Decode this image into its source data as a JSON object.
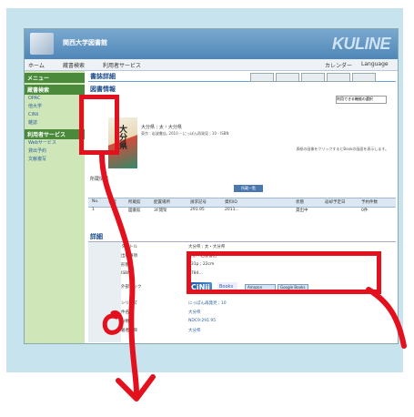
{
  "window": {
    "university_name": "関西大学図書館",
    "brand": "KULINE"
  },
  "nav": {
    "home": "ホーム",
    "catalog": "蔵書検索",
    "service": "利用者サービス",
    "calendar": "カレンダー",
    "language": "Language"
  },
  "sidebar": {
    "menu_head": "メニュー",
    "section1": "蔵書検索",
    "items1": [
      "OPAC",
      "他大学",
      "CiNii",
      "雑誌"
    ],
    "section2": "利用者サービス",
    "items2": [
      "Webサービス",
      "貸出予約",
      "文献複写"
    ]
  },
  "main": {
    "title": "書誌詳細",
    "subtitle": "図書情報",
    "select_label": "利用できる機能の選択"
  },
  "book": {
    "title_vertical": "大分県",
    "bib_line": "大分県 ; 太・大分県",
    "bib_line2": "東京 : 岩波書店, 2010 -- にっぽん再発見 ; 10 - ISBN",
    "note": "表紙の画像をクリックするとBookの画面を表示します。"
  },
  "holdings": {
    "heading": "所蔵情報",
    "button": "所蔵一覧",
    "columns": [
      "No.",
      "巻次",
      "所蔵館",
      "配置場所",
      "請求記号",
      "資料ID",
      "状態",
      "返却予定日",
      "予約件数"
    ],
    "row": [
      "1",
      "",
      "図書館",
      "3F開架",
      "291.95",
      "2011...",
      "貸出中",
      "",
      "0件"
    ]
  },
  "detail": {
    "heading": "詳細",
    "keys": [
      "タイトル",
      "出版事項",
      "形態",
      "ISBN",
      "外部リンク",
      "シリーズ",
      "件名",
      "分類",
      "著者標目"
    ],
    "values": [
      "大分県 ; 太・大分県",
      "東京 : 岩波書店",
      "131p ; 22cm",
      "9784...",
      "",
      "にっぽん再発見 ; 10",
      "大分県",
      "NDC9:291.95",
      "大分県"
    ],
    "link_buttons": [
      "Amazon",
      "Google Books"
    ],
    "cinii_label": "CiNii",
    "ref_label": "Books"
  },
  "colors": {
    "annotation_red": "#e3111d",
    "banner_blue": "#4f86b8",
    "sidebar_green": "#cfe6b8"
  }
}
